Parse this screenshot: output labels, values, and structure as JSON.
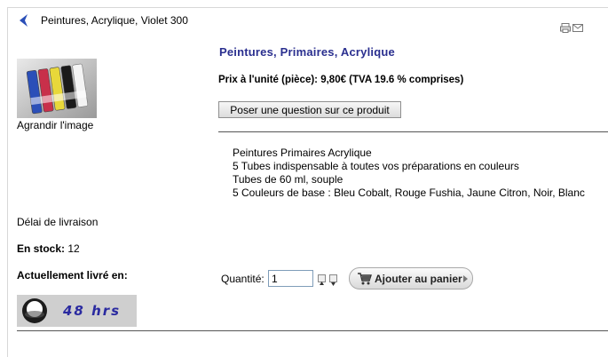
{
  "nav": {
    "previous_product": "Peintures, Acrylique, Violet 300"
  },
  "toolbar": {
    "icons": [
      "print-icon",
      "email-icon"
    ]
  },
  "product": {
    "title": "Peintures, Primaires, Acrylique",
    "price_line": "Prix à l'unité (pièce): 9,80€ (TVA 19.6 % comprises)",
    "ask_question_label": "Poser une question sur ce produit",
    "description": [
      "Peintures Primaires Acrylique",
      "5 Tubes indispensable à toutes vos préparations en couleurs",
      "Tubes de 60 ml, souple",
      "5 Couleurs de base : Bleu Cobalt, Rouge Fushia, Jaune Citron, Noir, Blanc"
    ],
    "enlarge_label": "Agrandir l'image",
    "delivery_delay_label": "Délai de livraison",
    "stock_label": "En stock:",
    "stock_value": "12",
    "delivered_in_label": "Actuellement livré en:",
    "delivery_badge_text": "48 hrs"
  },
  "cart": {
    "quantity_label": "Quantité:",
    "quantity_value": "1",
    "add_to_cart_label": "Ajouter au panier"
  },
  "colors": {
    "title": "#2a2f8f",
    "badge_text": "#2a2aa0",
    "tube_colors": [
      "#2b4fb8",
      "#c8304a",
      "#e8d83a",
      "#1a1a1a",
      "#f4f4f4"
    ]
  }
}
